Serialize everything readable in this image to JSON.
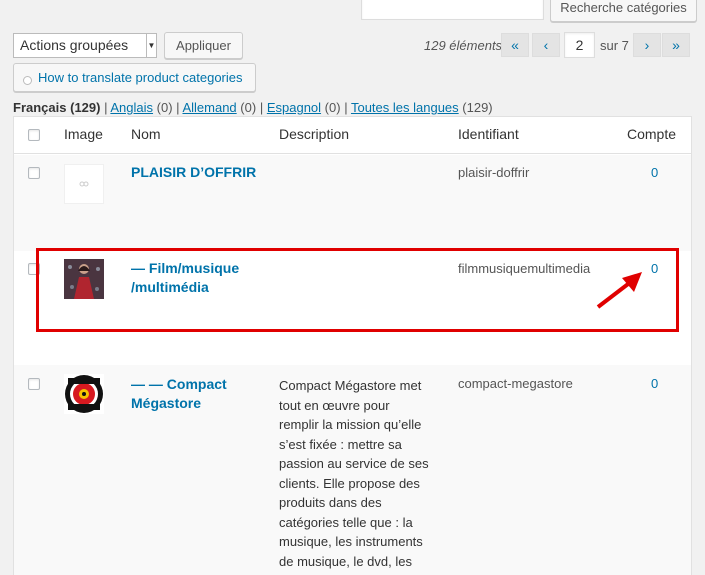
{
  "toolbar": {
    "search_button_label": "Recherche catégories",
    "bulk_actions": {
      "selected": "Actions groupées"
    },
    "apply_label": "Appliquer",
    "help_button_label": "How to translate product categories"
  },
  "pagination": {
    "items_count": "129 éléments",
    "first": "«",
    "prev": "‹",
    "current_page": "2",
    "of_label": "sur 7",
    "next": "›",
    "last": "»"
  },
  "languages": {
    "current": {
      "label": "Français",
      "count": "(129)"
    },
    "others": [
      {
        "label": "Anglais",
        "count": "(0)"
      },
      {
        "label": "Allemand",
        "count": "(0)"
      },
      {
        "label": "Espagnol",
        "count": "(0)"
      },
      {
        "label": "Toutes les langues",
        "count": "(129)"
      }
    ],
    "separator": "|"
  },
  "table": {
    "columns": [
      "Image",
      "Nom",
      "Description",
      "Identifiant",
      "Compte"
    ],
    "rows": [
      {
        "name": "PLAISIR D’OFFRIR",
        "description": "",
        "slug": "plaisir-doffrir",
        "count": "0",
        "image": "placeholder-image"
      },
      {
        "name_line1": "— Film/musique",
        "name_line2": "/multimédia",
        "description": "",
        "slug": "filmmusiquemultimedia",
        "count": "0",
        "image": "woman-red-dress-photo"
      },
      {
        "name_line1": "— — Compact",
        "name_line2": "Mégastore",
        "description_lines": [
          "Compact Mégastore met",
          "tout en œuvre pour",
          "remplir la mission qu’elle",
          "s’est fixée : mettre sa",
          "passion au service de ses",
          "clients. Elle propose des",
          "produits dans des",
          "catégories telle que : la",
          "musique, les instruments",
          "de musique, le dvd, les"
        ],
        "slug": "compact-megastore",
        "count": "0",
        "image": "compact-megastore-logo"
      }
    ]
  },
  "annotation": {
    "box_color": "#e00000",
    "arrow_color": "#e00000"
  },
  "colors": {
    "link": "#0073aa",
    "background": "#f1f1f1"
  }
}
